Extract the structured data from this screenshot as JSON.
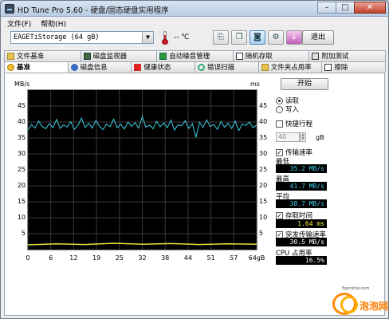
{
  "window": {
    "title": "HD Tune Pro 5.60 - 硬盘/固态硬盘实用程序"
  },
  "window_controls": {
    "minimize": "–",
    "maximize": "□",
    "close": "✕"
  },
  "menu": [
    "文件(F)",
    "帮助(H)"
  ],
  "toolbar": {
    "drive": "EAGETiStorage (64 gB)",
    "temperature": "-- ℃",
    "exit_label": "退出",
    "icons": [
      "copy-info-icon",
      "copy-info-all-icon",
      "screenshot-icon",
      "options-icon",
      "save-icon"
    ]
  },
  "tabs_row1": [
    {
      "label": "文件基准",
      "icon": "folder-icon"
    },
    {
      "label": "磁盘监视器",
      "icon": "monitor-icon"
    },
    {
      "label": "自动噪音管理",
      "icon": "speaker-icon"
    },
    {
      "label": "随机存取",
      "icon": "dice-icon"
    },
    {
      "label": "附加测试",
      "icon": "extra-tests-icon"
    }
  ],
  "tabs_row2": [
    {
      "label": "基准",
      "icon": "benchmark-icon",
      "active": true
    },
    {
      "label": "磁盘信息",
      "icon": "info-icon",
      "active": false
    },
    {
      "label": "健康状态",
      "icon": "health-icon",
      "active": false
    },
    {
      "label": "错误扫描",
      "icon": "magnifier-icon",
      "active": false
    },
    {
      "label": "文件夹占用率",
      "icon": "folder-usage-icon",
      "active": false
    },
    {
      "label": "擦除",
      "icon": "erase-icon",
      "active": false
    }
  ],
  "controls": {
    "start_label": "开始",
    "read_label": "读取",
    "write_label": "写入",
    "read_selected": true,
    "quick_test_label": "快捷行程",
    "quick_test_checked": false,
    "quick_test_value": "40",
    "quick_test_unit": "gB",
    "transfer_rate_label": "传输速率",
    "transfer_rate_checked": true,
    "min_label": "最低",
    "min_value": "35.2 MB/s",
    "max_label": "最高",
    "max_value": "41.7 MB/s",
    "avg_label": "平均",
    "avg_value": "38.7 MB/s",
    "access_time_label": "存取时间",
    "access_time_checked": true,
    "access_time_value": "1.64 ms",
    "burst_label": "突发传输速率",
    "burst_checked": true,
    "burst_value": "30.5 MB/s",
    "cpu_label": "CPU 占用率",
    "cpu_value": "16.5%"
  },
  "watermark": {
    "site": "flgorilme.com",
    "brand": "泡泡网"
  },
  "chart_data": {
    "type": "line",
    "y_left_unit": "MB/s",
    "y_right_unit": "ms",
    "y_left_ticks": [
      "45",
      "40",
      "35",
      "30",
      "25",
      "20",
      "15",
      "10",
      "5"
    ],
    "y_right_ticks": [
      "45",
      "40",
      "35",
      "30",
      "25",
      "20",
      "15",
      "10",
      "5"
    ],
    "ylim": [
      0,
      50
    ],
    "x_ticks": [
      "0",
      "6",
      "12",
      "19",
      "25",
      "32",
      "38",
      "44",
      "51",
      "57",
      "64gB"
    ],
    "xlim": [
      0,
      64
    ],
    "grid": true,
    "series": [
      {
        "name": "传输速率",
        "color": "#3ecfe8",
        "x": [
          0,
          1,
          2,
          3,
          4,
          5,
          6,
          7,
          8,
          9,
          10,
          11,
          12,
          13,
          14,
          15,
          16,
          17,
          18,
          19,
          20,
          21,
          22,
          23,
          24,
          25,
          26,
          27,
          28,
          29,
          30,
          31,
          32,
          33,
          34,
          35,
          36,
          37,
          38,
          39,
          40,
          41,
          42,
          43,
          44,
          45,
          46,
          47,
          48,
          49,
          50,
          51,
          52,
          53,
          54,
          55,
          56,
          57,
          58,
          59,
          60,
          61,
          62,
          63,
          64
        ],
        "values": [
          37.5,
          39.2,
          38.1,
          40.3,
          38.6,
          37.9,
          39.5,
          38.2,
          40.8,
          38.0,
          39.1,
          38.4,
          40.1,
          37.7,
          39.0,
          41.2,
          38.3,
          39.6,
          38.1,
          40.5,
          38.7,
          37.6,
          39.4,
          38.5,
          40.9,
          38.2,
          39.3,
          37.8,
          40.0,
          38.6,
          39.8,
          38.1,
          41.7,
          38.4,
          39.0,
          37.9,
          40.2,
          38.5,
          39.7,
          38.2,
          40.6,
          37.5,
          39.1,
          38.8,
          40.4,
          38.0,
          39.5,
          35.2,
          39.9,
          38.3,
          40.7,
          38.6,
          39.2,
          37.7,
          40.1,
          38.4,
          39.6,
          38.0,
          40.3,
          37.3,
          39.4,
          38.9,
          40.0,
          38.2,
          39.1
        ]
      },
      {
        "name": "存取时间",
        "color": "#e6e13a",
        "x": [
          0,
          8,
          16,
          24,
          32,
          40,
          48,
          56,
          64
        ],
        "values": [
          1.5,
          1.8,
          1.6,
          2.0,
          1.7,
          1.9,
          1.6,
          1.8,
          1.7
        ]
      }
    ]
  }
}
